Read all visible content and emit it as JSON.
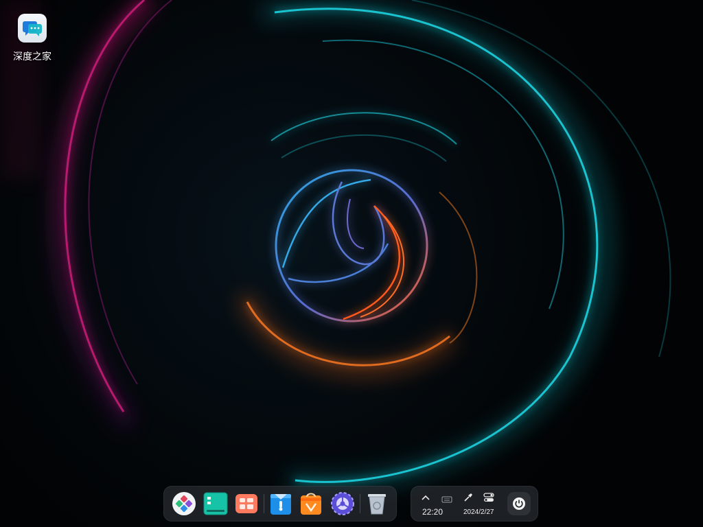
{
  "desktop": {
    "icons": [
      {
        "label": "深度之家",
        "icon": "deepin-home-icon"
      }
    ]
  },
  "dock": {
    "apps": [
      {
        "name": "launcher",
        "icon": "launcher-icon"
      },
      {
        "name": "multitasking-view",
        "icon": "multitasking-view-icon"
      },
      {
        "name": "workspace-switcher",
        "icon": "workspace-icon"
      },
      {
        "name": "file-manager",
        "icon": "file-manager-icon"
      },
      {
        "name": "app-store",
        "icon": "app-store-icon"
      },
      {
        "name": "control-center",
        "icon": "control-center-icon"
      },
      {
        "name": "trash",
        "icon": "trash-icon"
      }
    ]
  },
  "tray": {
    "time": "22:20",
    "date": "2024/2/27",
    "icons": [
      "chevron-up-icon",
      "keyboard-icon",
      "eyedropper-icon",
      "toggle-icon",
      "power-icon"
    ]
  },
  "colors": {
    "wallpaper_cyan": "#19d3e0",
    "wallpaper_magenta": "#c8157a",
    "wallpaper_orange": "#ff6a1a",
    "panel_bg": "#282c32"
  }
}
